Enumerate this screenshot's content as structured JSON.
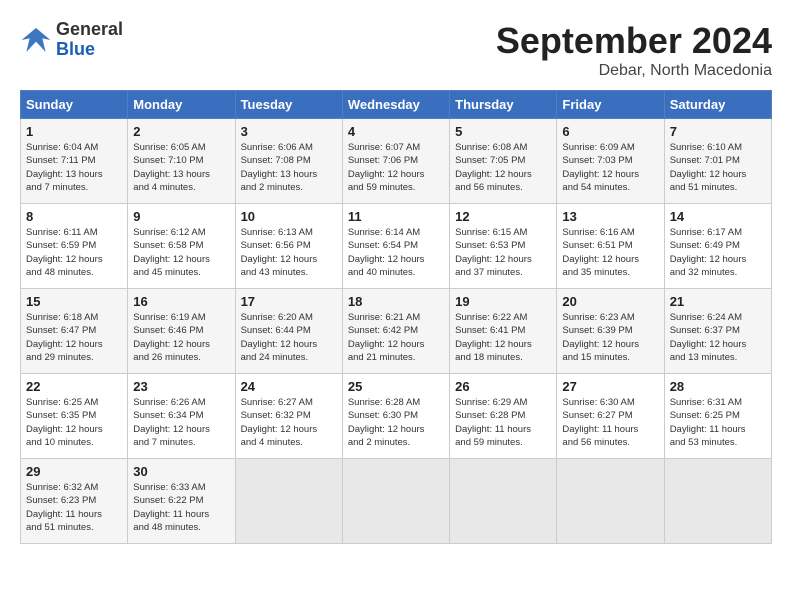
{
  "header": {
    "logo": {
      "line1": "General",
      "line2": "Blue"
    },
    "title": "September 2024",
    "subtitle": "Debar, North Macedonia"
  },
  "days_of_week": [
    "Sunday",
    "Monday",
    "Tuesday",
    "Wednesday",
    "Thursday",
    "Friday",
    "Saturday"
  ],
  "weeks": [
    [
      {
        "num": "1",
        "detail": "Sunrise: 6:04 AM\nSunset: 7:11 PM\nDaylight: 13 hours\nand 7 minutes."
      },
      {
        "num": "2",
        "detail": "Sunrise: 6:05 AM\nSunset: 7:10 PM\nDaylight: 13 hours\nand 4 minutes."
      },
      {
        "num": "3",
        "detail": "Sunrise: 6:06 AM\nSunset: 7:08 PM\nDaylight: 13 hours\nand 2 minutes."
      },
      {
        "num": "4",
        "detail": "Sunrise: 6:07 AM\nSunset: 7:06 PM\nDaylight: 12 hours\nand 59 minutes."
      },
      {
        "num": "5",
        "detail": "Sunrise: 6:08 AM\nSunset: 7:05 PM\nDaylight: 12 hours\nand 56 minutes."
      },
      {
        "num": "6",
        "detail": "Sunrise: 6:09 AM\nSunset: 7:03 PM\nDaylight: 12 hours\nand 54 minutes."
      },
      {
        "num": "7",
        "detail": "Sunrise: 6:10 AM\nSunset: 7:01 PM\nDaylight: 12 hours\nand 51 minutes."
      }
    ],
    [
      {
        "num": "8",
        "detail": "Sunrise: 6:11 AM\nSunset: 6:59 PM\nDaylight: 12 hours\nand 48 minutes."
      },
      {
        "num": "9",
        "detail": "Sunrise: 6:12 AM\nSunset: 6:58 PM\nDaylight: 12 hours\nand 45 minutes."
      },
      {
        "num": "10",
        "detail": "Sunrise: 6:13 AM\nSunset: 6:56 PM\nDaylight: 12 hours\nand 43 minutes."
      },
      {
        "num": "11",
        "detail": "Sunrise: 6:14 AM\nSunset: 6:54 PM\nDaylight: 12 hours\nand 40 minutes."
      },
      {
        "num": "12",
        "detail": "Sunrise: 6:15 AM\nSunset: 6:53 PM\nDaylight: 12 hours\nand 37 minutes."
      },
      {
        "num": "13",
        "detail": "Sunrise: 6:16 AM\nSunset: 6:51 PM\nDaylight: 12 hours\nand 35 minutes."
      },
      {
        "num": "14",
        "detail": "Sunrise: 6:17 AM\nSunset: 6:49 PM\nDaylight: 12 hours\nand 32 minutes."
      }
    ],
    [
      {
        "num": "15",
        "detail": "Sunrise: 6:18 AM\nSunset: 6:47 PM\nDaylight: 12 hours\nand 29 minutes."
      },
      {
        "num": "16",
        "detail": "Sunrise: 6:19 AM\nSunset: 6:46 PM\nDaylight: 12 hours\nand 26 minutes."
      },
      {
        "num": "17",
        "detail": "Sunrise: 6:20 AM\nSunset: 6:44 PM\nDaylight: 12 hours\nand 24 minutes."
      },
      {
        "num": "18",
        "detail": "Sunrise: 6:21 AM\nSunset: 6:42 PM\nDaylight: 12 hours\nand 21 minutes."
      },
      {
        "num": "19",
        "detail": "Sunrise: 6:22 AM\nSunset: 6:41 PM\nDaylight: 12 hours\nand 18 minutes."
      },
      {
        "num": "20",
        "detail": "Sunrise: 6:23 AM\nSunset: 6:39 PM\nDaylight: 12 hours\nand 15 minutes."
      },
      {
        "num": "21",
        "detail": "Sunrise: 6:24 AM\nSunset: 6:37 PM\nDaylight: 12 hours\nand 13 minutes."
      }
    ],
    [
      {
        "num": "22",
        "detail": "Sunrise: 6:25 AM\nSunset: 6:35 PM\nDaylight: 12 hours\nand 10 minutes."
      },
      {
        "num": "23",
        "detail": "Sunrise: 6:26 AM\nSunset: 6:34 PM\nDaylight: 12 hours\nand 7 minutes."
      },
      {
        "num": "24",
        "detail": "Sunrise: 6:27 AM\nSunset: 6:32 PM\nDaylight: 12 hours\nand 4 minutes."
      },
      {
        "num": "25",
        "detail": "Sunrise: 6:28 AM\nSunset: 6:30 PM\nDaylight: 12 hours\nand 2 minutes."
      },
      {
        "num": "26",
        "detail": "Sunrise: 6:29 AM\nSunset: 6:28 PM\nDaylight: 11 hours\nand 59 minutes."
      },
      {
        "num": "27",
        "detail": "Sunrise: 6:30 AM\nSunset: 6:27 PM\nDaylight: 11 hours\nand 56 minutes."
      },
      {
        "num": "28",
        "detail": "Sunrise: 6:31 AM\nSunset: 6:25 PM\nDaylight: 11 hours\nand 53 minutes."
      }
    ],
    [
      {
        "num": "29",
        "detail": "Sunrise: 6:32 AM\nSunset: 6:23 PM\nDaylight: 11 hours\nand 51 minutes."
      },
      {
        "num": "30",
        "detail": "Sunrise: 6:33 AM\nSunset: 6:22 PM\nDaylight: 11 hours\nand 48 minutes."
      },
      null,
      null,
      null,
      null,
      null
    ]
  ]
}
